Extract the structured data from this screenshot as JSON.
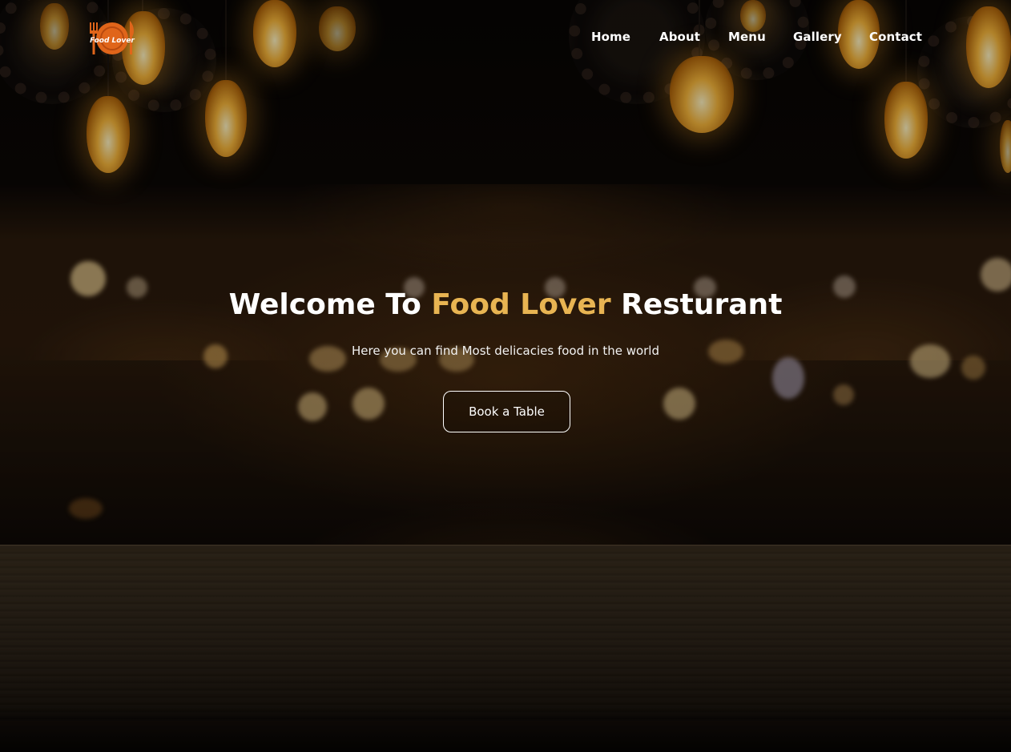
{
  "brand": {
    "logo_text": "Food Lover",
    "accent_color": "#e8b452",
    "logo_color": "#e0651a"
  },
  "nav": {
    "items": [
      {
        "label": "Home"
      },
      {
        "label": "About"
      },
      {
        "label": "Menu"
      },
      {
        "label": "Gallery"
      },
      {
        "label": "Contact"
      }
    ]
  },
  "hero": {
    "headline_prefix": "Welcome To ",
    "headline_accent": "Food Lover",
    "headline_suffix": " Resturant",
    "subtitle": "Here you can find Most delicacies food in the world",
    "cta_label": "Book a Table",
    "background": "restaurant-bokeh-with-hanging-bulbs-and-wooden-table"
  }
}
